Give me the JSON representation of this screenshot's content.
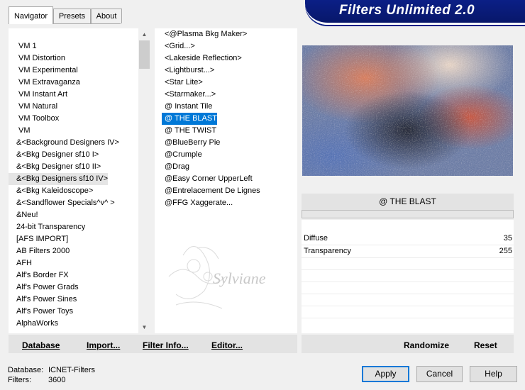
{
  "tabs": [
    {
      "label": "Navigator",
      "active": true
    },
    {
      "label": "Presets",
      "active": false
    },
    {
      "label": "About",
      "active": false
    }
  ],
  "banner": {
    "title": "Filters Unlimited 2.0"
  },
  "categories": {
    "items": [
      "VM 1",
      "VM Distortion",
      "VM Experimental",
      "VM Extravaganza",
      "VM Instant Art",
      "VM Natural",
      "VM Toolbox",
      "VM",
      "&<Background Designers IV>",
      "&<Bkg Designer sf10 I>",
      "&<Bkg Designer sf10 II>",
      "&<Bkg Designers sf10 IV>",
      "&<Bkg Kaleidoscope>",
      "&<Sandflower Specials^v^ >",
      "&Neu!",
      "24-bit Transparency",
      "[AFS IMPORT]",
      "AB Filters 2000",
      "AFH",
      "Alf's Border FX",
      "Alf's Power Grads",
      "Alf's Power Sines",
      "Alf's Power Toys",
      "AlphaWorks"
    ],
    "highlighted_index": 11
  },
  "filters": {
    "items": [
      "<@Plasma Bkg Maker>",
      "<Grid...>",
      "<Lakeside Reflection>",
      "<Lightburst...>",
      "<Star Lite>",
      "<Starmaker...>",
      "@ Instant Tile",
      "@ THE BLAST",
      "@ THE TWIST",
      "@BlueBerry Pie",
      "@Crumple",
      "@Drag",
      "@Easy Corner UpperLeft",
      "@Entrelacement De Lignes",
      "@FFG Xaggerate..."
    ],
    "selected_index": 7
  },
  "watermark": {
    "text": "Sylviane"
  },
  "preview": {
    "filter_name": "@ THE BLAST"
  },
  "parameters": [
    {
      "name": "Diffuse",
      "value": "35"
    },
    {
      "name": "Transparency",
      "value": "255"
    }
  ],
  "bottom_buttons": {
    "database": "Database",
    "import": "Import...",
    "filter_info": "Filter Info...",
    "editor": "Editor...",
    "randomize": "Randomize",
    "reset": "Reset"
  },
  "status": {
    "database_label": "Database:",
    "database_value": "ICNET-Filters",
    "filters_label": "Filters:",
    "filters_value": "3600"
  },
  "dialog_buttons": {
    "apply": "Apply",
    "cancel": "Cancel",
    "help": "Help"
  },
  "colors": {
    "selection": "#0078d7",
    "banner": "#0b1f86"
  }
}
